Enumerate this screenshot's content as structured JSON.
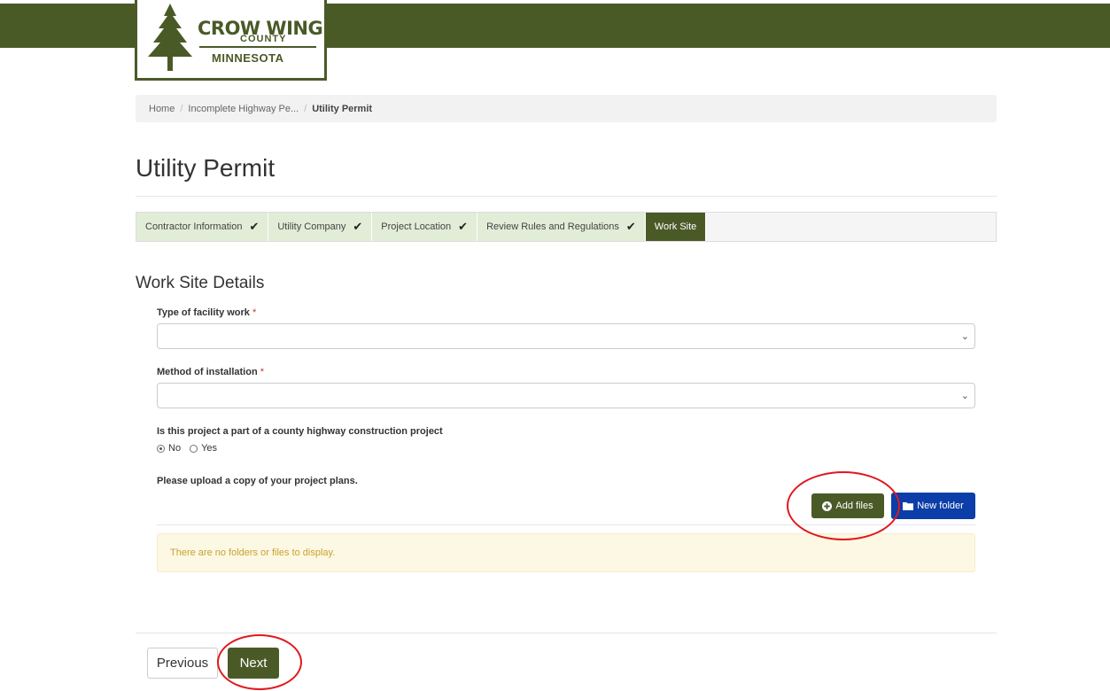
{
  "header": {
    "logo": {
      "line1": "CROW WING",
      "line2": "COUNTY",
      "line3": "MINNESOTA"
    }
  },
  "breadcrumb": {
    "items": [
      "Home",
      "Incomplete Highway Pe...",
      "Utility Permit"
    ],
    "separator": "/"
  },
  "page": {
    "title": "Utility Permit"
  },
  "steps": [
    {
      "label": "Contractor Information",
      "done": true
    },
    {
      "label": "Utility Company",
      "done": true
    },
    {
      "label": "Project Location",
      "done": true
    },
    {
      "label": "Review Rules and Regulations",
      "done": true
    },
    {
      "label": "Work Site",
      "done": false,
      "active": true
    }
  ],
  "section": {
    "title": "Work Site Details"
  },
  "form": {
    "facility_label": "Type of facility work",
    "facility_value": "",
    "method_label": "Method of installation",
    "method_value": "",
    "required_marker": "*",
    "county_project_label": "Is this project a part of a county highway construction project",
    "radio_no": "No",
    "radio_yes": "Yes",
    "radio_selected": "No",
    "upload_label": "Please upload a copy of your project plans."
  },
  "files": {
    "add_label": "Add files",
    "new_folder_label": "New folder",
    "empty_message": "There are no folders or files to display."
  },
  "nav": {
    "previous_label": "Previous",
    "next_label": "Next"
  },
  "colors": {
    "brand": "#4a5a27",
    "step_done_bg": "#e1edd7",
    "folder_button": "#0b3ea8",
    "notice_bg": "#fcf8e3",
    "notice_text": "#c8a232",
    "annotation": "#e0191e"
  }
}
